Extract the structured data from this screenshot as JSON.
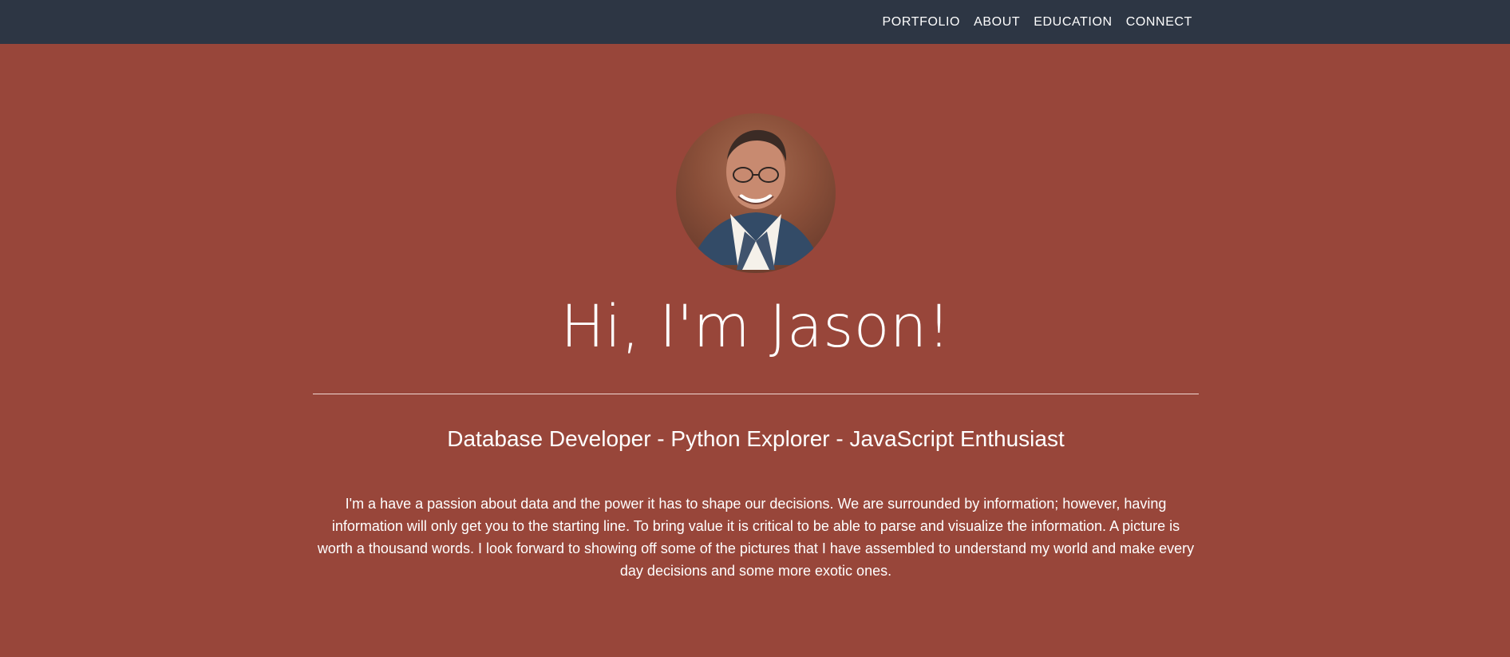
{
  "nav": {
    "items": [
      {
        "label": "PORTFOLIO"
      },
      {
        "label": "ABOUT"
      },
      {
        "label": "EDUCATION"
      },
      {
        "label": "CONNECT"
      }
    ]
  },
  "hero": {
    "headline": "Hi, I'm Jason!",
    "subtitle": "Database Developer - Python Explorer - JavaScript Enthusiast",
    "bio": "I'm a have a passion about data and the power it has to shape our decisions. We are surrounded by information; however, having information will only get you to the starting line. To bring value it is critical to be able to parse and visualize the information. A picture is worth a thousand words. I look forward to showing off some of the pictures that I have assembled to understand my world and make every day decisions and some more exotic ones."
  },
  "colors": {
    "navbar_background": "#2d3644",
    "page_background": "#98463a",
    "text": "#ffffff"
  }
}
